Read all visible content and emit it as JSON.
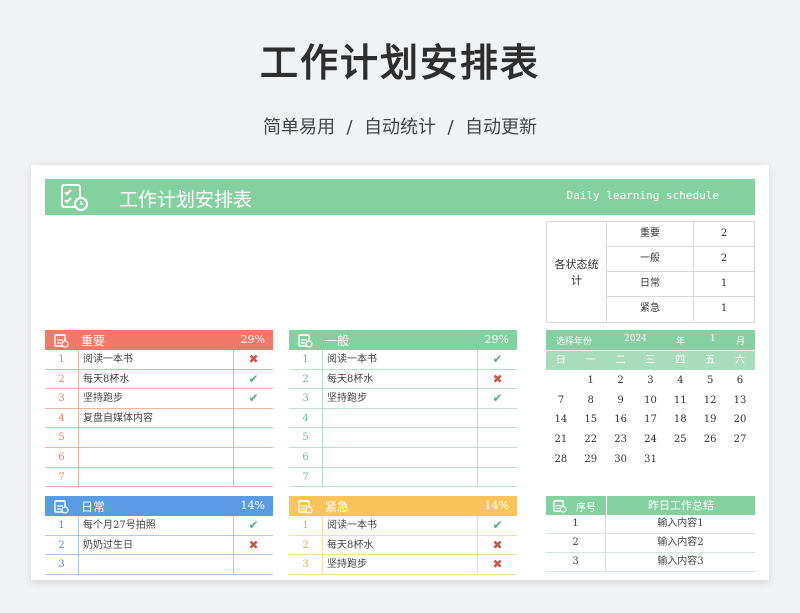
{
  "header": {
    "title": "工作计划安排表",
    "subtitle": "简单易用  /  自动统计  /  自动更新"
  },
  "banner": {
    "title": "工作计划安排表",
    "subtitle_en": "Daily learning schedule",
    "icon": "checklist-clock-icon"
  },
  "status_table": {
    "label": "各状态统计",
    "rows": [
      {
        "name": "重要",
        "count": "2"
      },
      {
        "name": "一般",
        "count": "2"
      },
      {
        "name": "日常",
        "count": "1"
      },
      {
        "name": "紧急",
        "count": "1"
      }
    ]
  },
  "panels": {
    "important": {
      "title": "重要",
      "percent": "29%",
      "color": "#f0796a",
      "line": "#f3b1a8",
      "num_color": "#e8806f",
      "rows": [
        {
          "num": "1",
          "text": "阅读一本书",
          "mark": "✖",
          "status": "no"
        },
        {
          "num": "2",
          "text": "每天8杯水",
          "mark": "✔",
          "status": "yes"
        },
        {
          "num": "3",
          "text": "坚持跑步",
          "mark": "✔",
          "status": "yes"
        },
        {
          "num": "4",
          "text": "复盘自媒体内容",
          "mark": "",
          "status": ""
        },
        {
          "num": "5",
          "text": "",
          "mark": "",
          "status": ""
        },
        {
          "num": "6",
          "text": "",
          "mark": "",
          "status": ""
        },
        {
          "num": "7",
          "text": "",
          "mark": "",
          "status": ""
        }
      ]
    },
    "general": {
      "title": "一般",
      "percent": "29%",
      "color": "#84d0a1",
      "line": "#b7e2c7",
      "num_color": "#6fbf8d",
      "rows": [
        {
          "num": "1",
          "text": "阅读一本书",
          "mark": "✔",
          "status": "yes"
        },
        {
          "num": "2",
          "text": "每天8杯水",
          "mark": "✖",
          "status": "no"
        },
        {
          "num": "3",
          "text": "坚持跑步",
          "mark": "✔",
          "status": "yes"
        },
        {
          "num": "4",
          "text": "",
          "mark": "",
          "status": ""
        },
        {
          "num": "5",
          "text": "",
          "mark": "",
          "status": ""
        },
        {
          "num": "6",
          "text": "",
          "mark": "",
          "status": ""
        },
        {
          "num": "7",
          "text": "",
          "mark": "",
          "status": ""
        }
      ]
    },
    "daily": {
      "title": "日常",
      "percent": "14%",
      "color": "#5b9be6",
      "line": "#a9c9f0",
      "num_color": "#5b8fd6",
      "rows": [
        {
          "num": "1",
          "text": "每个月27号拍照",
          "mark": "✔",
          "status": "yes"
        },
        {
          "num": "2",
          "text": "奶奶过生日",
          "mark": "✖",
          "status": "no"
        },
        {
          "num": "3",
          "text": "",
          "mark": "",
          "status": ""
        }
      ]
    },
    "urgent": {
      "title": "紧急",
      "percent": "14%",
      "color": "#f9c45a",
      "line": "#f8dda3",
      "num_color": "#e9ad3d",
      "rows": [
        {
          "num": "1",
          "text": "阅读一本书",
          "mark": "✔",
          "status": "yes"
        },
        {
          "num": "2",
          "text": "每天8杯水",
          "mark": "✖",
          "status": "no"
        },
        {
          "num": "3",
          "text": "坚持跑步",
          "mark": "✖",
          "status": "no"
        }
      ]
    }
  },
  "calendar": {
    "select_label": "选择年份",
    "year": "2024",
    "year_unit": "年",
    "month": "1",
    "month_unit": "月",
    "weekdays": [
      "日",
      "一",
      "二",
      "三",
      "四",
      "五",
      "六"
    ],
    "weeks": [
      [
        "",
        "1",
        "2",
        "3",
        "4",
        "5",
        "6"
      ],
      [
        "7",
        "8",
        "9",
        "10",
        "11",
        "12",
        "13"
      ],
      [
        "14",
        "15",
        "16",
        "17",
        "18",
        "19",
        "20"
      ],
      [
        "21",
        "22",
        "23",
        "24",
        "25",
        "26",
        "27"
      ],
      [
        "28",
        "29",
        "30",
        "31",
        "",
        "",
        ""
      ]
    ]
  },
  "summary": {
    "col_num": "序号",
    "col_title": "昨日工作总结",
    "rows": [
      {
        "num": "1",
        "text": "输入内容1"
      },
      {
        "num": "2",
        "text": "输入内容2"
      },
      {
        "num": "3",
        "text": "输入内容3"
      }
    ]
  }
}
